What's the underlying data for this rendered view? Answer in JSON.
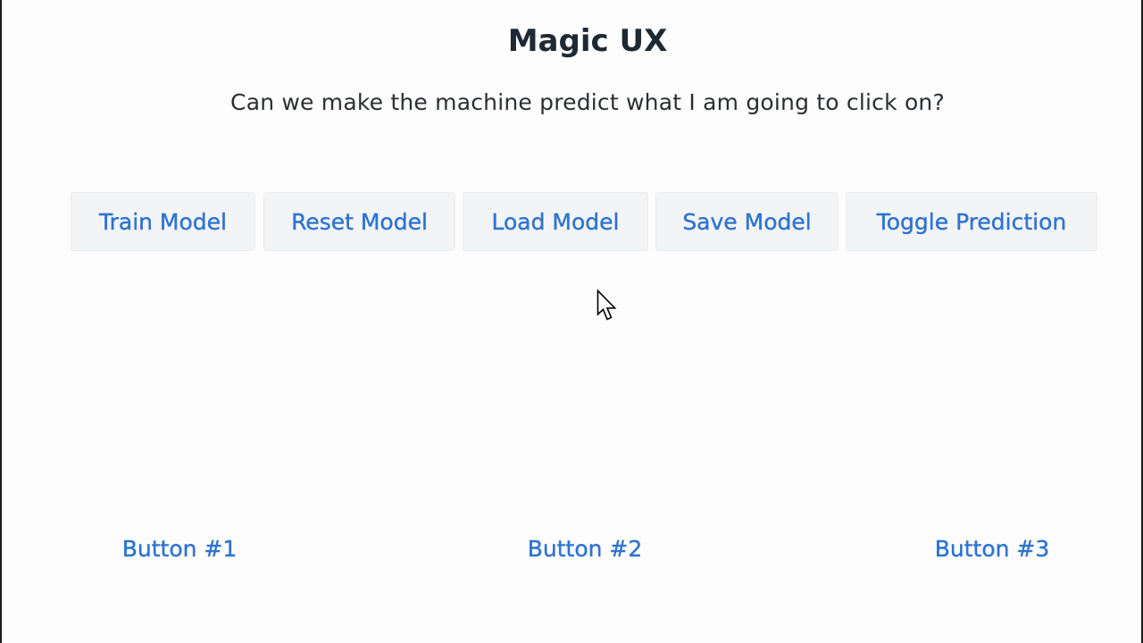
{
  "header": {
    "title": "Magic UX",
    "subtitle": "Can we make the machine predict what I am going to click on?"
  },
  "toolbar": {
    "train_label": "Train Model",
    "reset_label": "Reset Model",
    "load_label": "Load Model",
    "save_label": "Save Model",
    "toggle_label": "Toggle Prediction"
  },
  "targets": {
    "button1_label": "Button #1",
    "button2_label": "Button #2",
    "button3_label": "Button #3"
  },
  "colors": {
    "accent": "#2f74d0",
    "button_bg": "#f2f4f6",
    "text": "#1f2933",
    "background": "#fdfdfd"
  },
  "icons": {
    "cursor": "mouse-pointer-icon"
  }
}
